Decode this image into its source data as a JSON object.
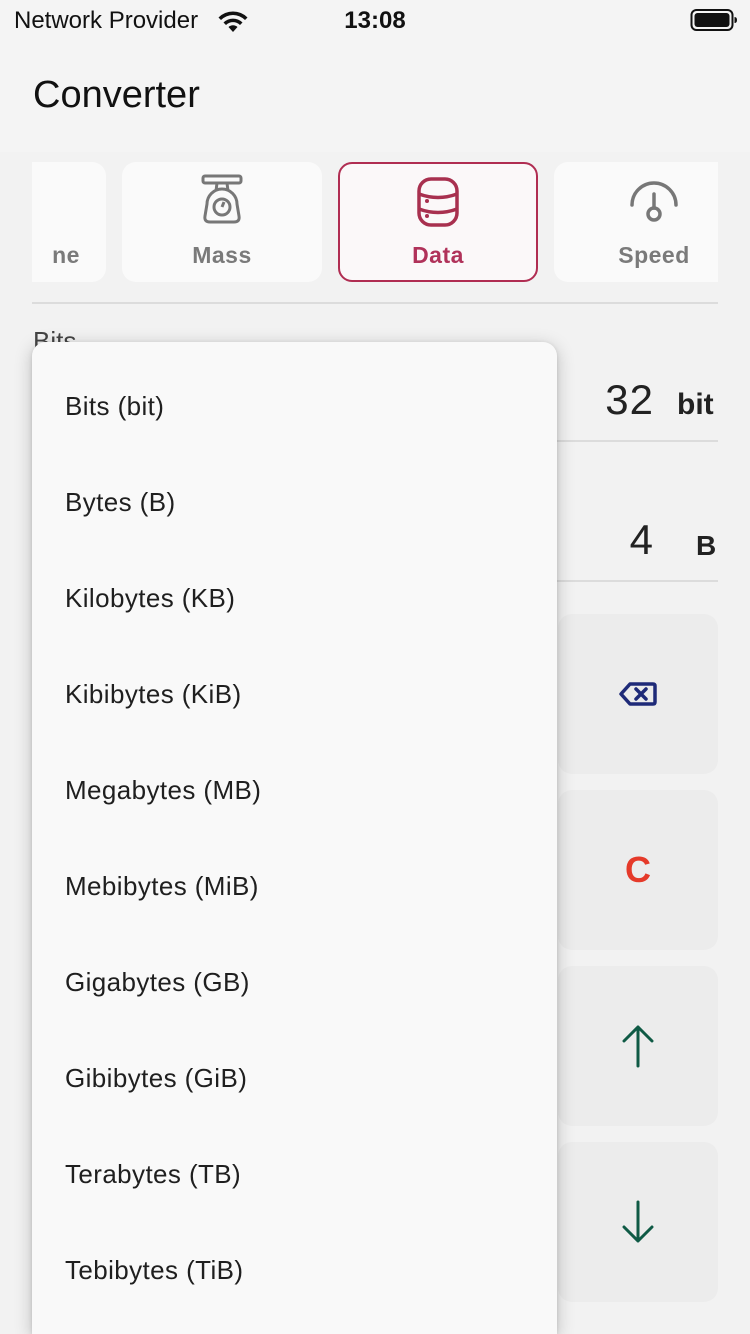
{
  "status_bar": {
    "carrier": "Network Provider",
    "time": "13:08",
    "wifi_icon": "wifi-icon",
    "battery_icon": "battery-icon"
  },
  "header": {
    "title": "Converter"
  },
  "categories": [
    {
      "label": "ne",
      "icon": "none",
      "active": false
    },
    {
      "label": "Mass",
      "icon": "scale-icon",
      "active": false
    },
    {
      "label": "Data",
      "icon": "database-icon",
      "active": true
    },
    {
      "label": "Speed",
      "icon": "speedometer-icon",
      "active": false
    }
  ],
  "from_unit": {
    "selected": "Bits",
    "value": "32",
    "unit": "bit"
  },
  "to_unit": {
    "value": "4",
    "unit": "B"
  },
  "keypad": {
    "backspace_icon": "backspace-icon",
    "clear_label": "C",
    "up_icon": "arrow-up-icon",
    "down_icon": "arrow-down-icon"
  },
  "dropdown": {
    "options": [
      "Bits (bit)",
      "Bytes (B)",
      "Kilobytes (KB)",
      "Kibibytes (KiB)",
      "Megabytes (MB)",
      "Mebibytes (MiB)",
      "Gigabytes (GB)",
      "Gibibytes (GiB)",
      "Terabytes (TB)",
      "Tebibytes (TiB)"
    ]
  },
  "colors": {
    "accent": "#b02d52",
    "clear": "#e53a2a",
    "backspace": "#1e2a78",
    "arrows": "#0f5a45"
  }
}
